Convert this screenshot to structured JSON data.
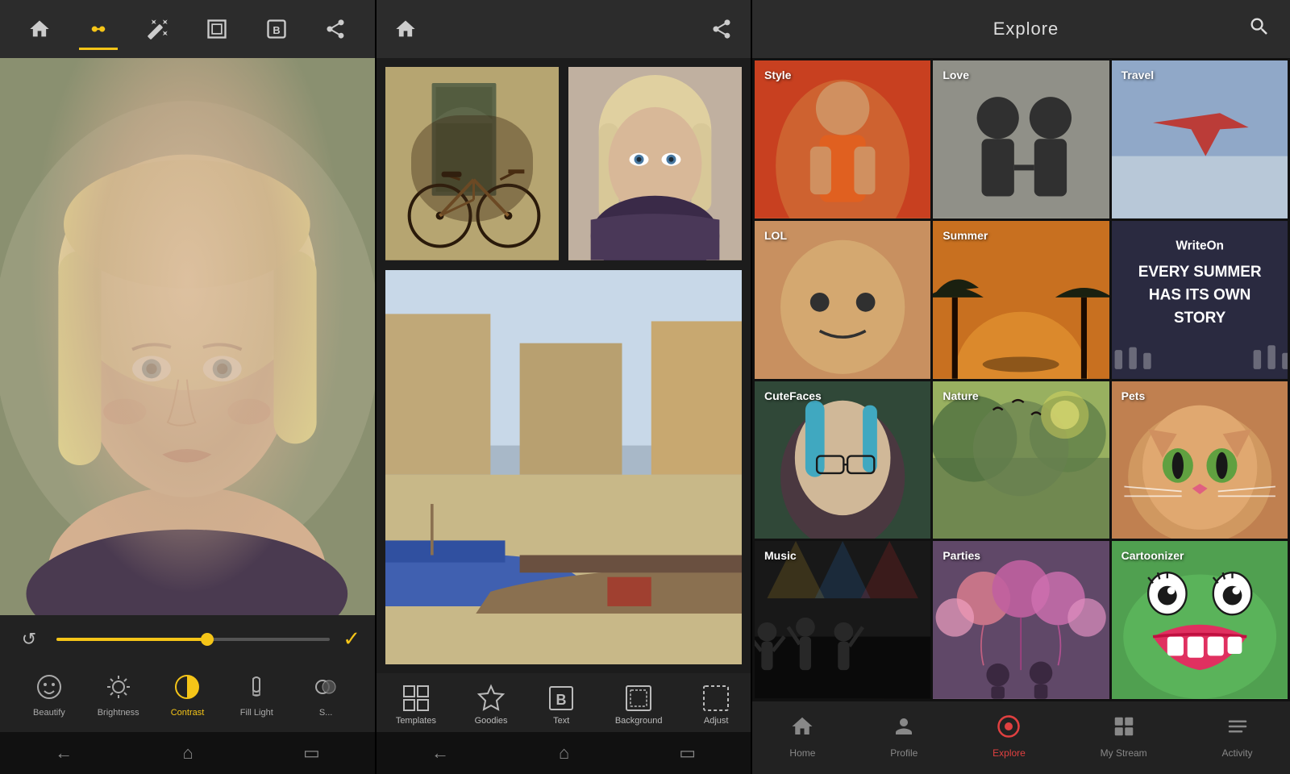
{
  "panel1": {
    "toolbar": {
      "home_label": "home",
      "adjust_label": "adjust",
      "magic_label": "magic",
      "frame_label": "frame",
      "bold_label": "bold",
      "share_label": "share"
    },
    "controls": {
      "undo_symbol": "↺",
      "check_symbol": "✓",
      "slider_percent": 55
    },
    "tools": [
      {
        "id": "beautify",
        "label": "Beautify",
        "active": false
      },
      {
        "id": "brightness",
        "label": "Brightness",
        "active": false
      },
      {
        "id": "contrast",
        "label": "Contrast",
        "active": true
      },
      {
        "id": "fill_light",
        "label": "Fill Light",
        "active": false
      },
      {
        "id": "shadows",
        "label": "Shadows",
        "active": false
      }
    ],
    "nav": [
      "←",
      "⌂",
      "▭"
    ]
  },
  "panel2": {
    "toolbar": {
      "home_label": "home",
      "share_label": "share"
    },
    "tools": [
      {
        "id": "templates",
        "label": "Templates"
      },
      {
        "id": "goodies",
        "label": "Goodies"
      },
      {
        "id": "text",
        "label": "Text"
      },
      {
        "id": "background",
        "label": "Background"
      },
      {
        "id": "adjust",
        "label": "Adjust"
      }
    ],
    "nav": [
      "←",
      "⌂",
      "▭"
    ]
  },
  "panel3": {
    "header": {
      "title": "Explore",
      "search_symbol": "🔍"
    },
    "grid": [
      {
        "id": "style",
        "label": "Style",
        "bg_class": "style-bg"
      },
      {
        "id": "love",
        "label": "Love",
        "bg_class": "love-bg"
      },
      {
        "id": "travel",
        "label": "Travel",
        "bg_class": "travel-bg"
      },
      {
        "id": "lol",
        "label": "LOL",
        "bg_class": "lol-bg"
      },
      {
        "id": "summer",
        "label": "Summer",
        "bg_class": "summer-bg"
      },
      {
        "id": "writeon",
        "label": "WriteOn",
        "bg_class": "writeon-bg"
      },
      {
        "id": "cutefaces",
        "label": "CuteFaces",
        "bg_class": "cutefaces-bg"
      },
      {
        "id": "nature",
        "label": "Nature",
        "bg_class": "nature-bg"
      },
      {
        "id": "pets",
        "label": "Pets",
        "bg_class": "pets-bg"
      },
      {
        "id": "music",
        "label": "Music",
        "bg_class": "music-bg"
      },
      {
        "id": "parties",
        "label": "Parties",
        "bg_class": "parties-bg"
      },
      {
        "id": "cartoonizer",
        "label": "Cartoonizer",
        "bg_class": "cartoonizer-bg"
      }
    ],
    "writeon_text": "EVERY SUMMER HAS ITS OWN STORY",
    "nav": [
      {
        "id": "home",
        "label": "Home",
        "symbol": "⌂",
        "active": false
      },
      {
        "id": "profile",
        "label": "Profile",
        "symbol": "👤",
        "active": false
      },
      {
        "id": "explore",
        "label": "Explore",
        "symbol": "🌐",
        "active": true
      },
      {
        "id": "mystream",
        "label": "My Stream",
        "symbol": "⊞",
        "active": false
      },
      {
        "id": "activity",
        "label": "Activity",
        "symbol": "≡",
        "active": false
      }
    ]
  }
}
